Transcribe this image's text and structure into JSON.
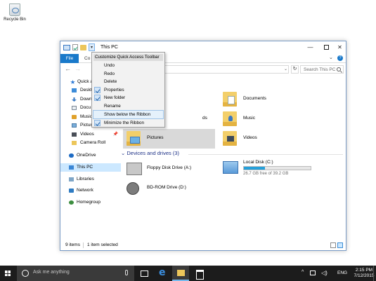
{
  "desktop": {
    "recycle_bin": "Recycle Bin"
  },
  "window": {
    "title": "This PC",
    "tab_file": "File",
    "tab_partial": "Co",
    "search_placeholder": "Search This PC",
    "status_count": "9 items",
    "status_selected": "1 item selected"
  },
  "qat_menu": {
    "title": "Customize Quick Access Toolbar",
    "items": [
      {
        "label": "Undo",
        "checked": false
      },
      {
        "label": "Redo",
        "checked": false
      },
      {
        "label": "Delete",
        "checked": false
      },
      {
        "label": "Properties",
        "checked": true
      },
      {
        "label": "New folder",
        "checked": true
      },
      {
        "label": "Rename",
        "checked": false
      },
      {
        "label": "Show below the Ribbon",
        "checked": false
      },
      {
        "label": "Minimize the Ribbon",
        "checked": true
      }
    ]
  },
  "nav": {
    "quick_access": "Quick a",
    "desktop": "Deskt",
    "downloads": "Down",
    "documents": "Docu",
    "music": "Music",
    "pictures": "Pictures",
    "videos": "Videos",
    "camera_roll": "Camera Roll",
    "onedrive": "OneDrive",
    "this_pc": "This PC",
    "libraries": "Libraries",
    "network": "Network",
    "homegroup": "Homegroup"
  },
  "folders": {
    "documents": "Documents",
    "downloads_partial": "ds",
    "music": "Music",
    "pictures": "Pictures",
    "videos": "Videos"
  },
  "devices": {
    "header": "Devices and drives (3)",
    "floppy": "Floppy Disk Drive (A:)",
    "local_disk": "Local Disk (C:)",
    "local_disk_space": "26.7 GB free of 39.2 GB",
    "local_disk_used_fraction": 0.32,
    "bdrom": "BD-ROM Drive (D:)"
  },
  "taskbar": {
    "search_text": "Ask me anything",
    "lang": "ENG",
    "time": "2:15 PM",
    "date": "7/12/2015"
  }
}
